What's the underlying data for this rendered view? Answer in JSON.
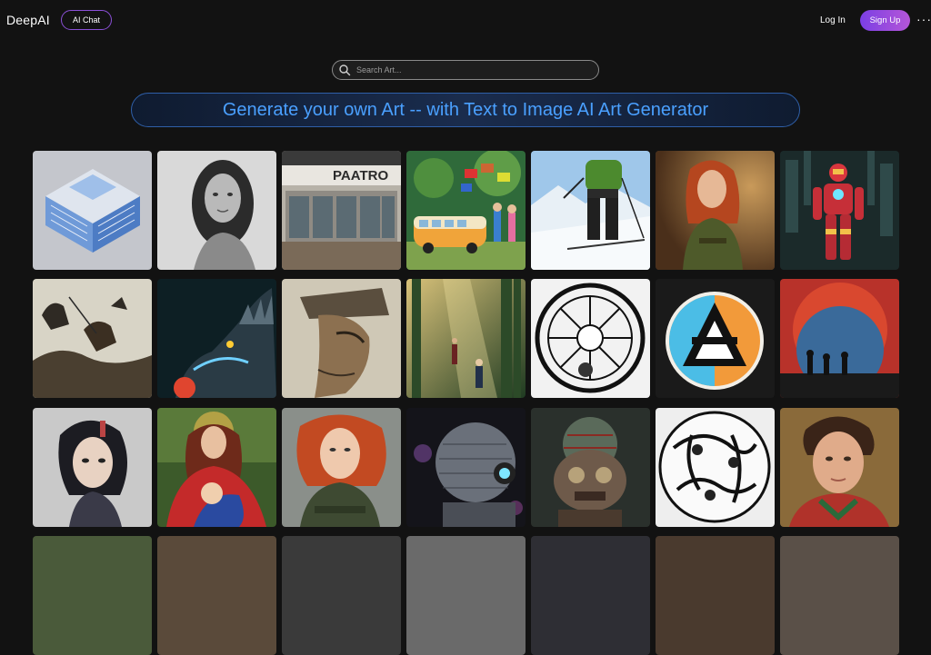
{
  "nav": {
    "logo": "DeepAI",
    "ai_chat": "AI Chat",
    "login": "Log In",
    "signup": "Sign Up",
    "more_icon": "more-dots-icon"
  },
  "search": {
    "placeholder": "Search Art..."
  },
  "banner": {
    "text": "Generate your own Art -- with Text to Image AI Art Generator"
  },
  "gallery": {
    "tiles": [
      {
        "id": "isometric-building",
        "sign": ""
      },
      {
        "id": "woman-portrait-bw",
        "sign": ""
      },
      {
        "id": "storefront",
        "sign": "PAATRO"
      },
      {
        "id": "bus-painting",
        "sign": ""
      },
      {
        "id": "skier",
        "sign": ""
      },
      {
        "id": "redhead-woman",
        "sign": ""
      },
      {
        "id": "iron-armor-robot",
        "sign": ""
      },
      {
        "id": "battle-sketch",
        "sign": ""
      },
      {
        "id": "dragon",
        "sign": ""
      },
      {
        "id": "warrior-portrait",
        "sign": ""
      },
      {
        "id": "forest-light",
        "sign": ""
      },
      {
        "id": "engraving-circle",
        "sign": ""
      },
      {
        "id": "triangle-logo",
        "sign": ""
      },
      {
        "id": "red-moon",
        "sign": ""
      },
      {
        "id": "anime-girl",
        "sign": ""
      },
      {
        "id": "madonna-child",
        "sign": ""
      },
      {
        "id": "redhead-girl",
        "sign": ""
      },
      {
        "id": "robot-head",
        "sign": ""
      },
      {
        "id": "mech-mask",
        "sign": ""
      },
      {
        "id": "monkeys-sketch",
        "sign": ""
      },
      {
        "id": "young-man-portrait",
        "sign": ""
      }
    ]
  }
}
